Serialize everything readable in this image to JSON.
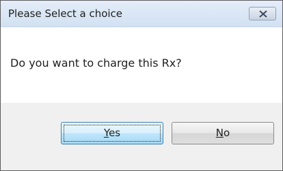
{
  "dialog": {
    "title": "Please Select a choice",
    "message": "Do you want to charge this Rx?",
    "close_icon": "close-icon",
    "buttons": {
      "yes": {
        "mnemonic": "Y",
        "rest": "es",
        "focused": true
      },
      "no": {
        "mnemonic": "N",
        "rest": "o"
      }
    }
  }
}
